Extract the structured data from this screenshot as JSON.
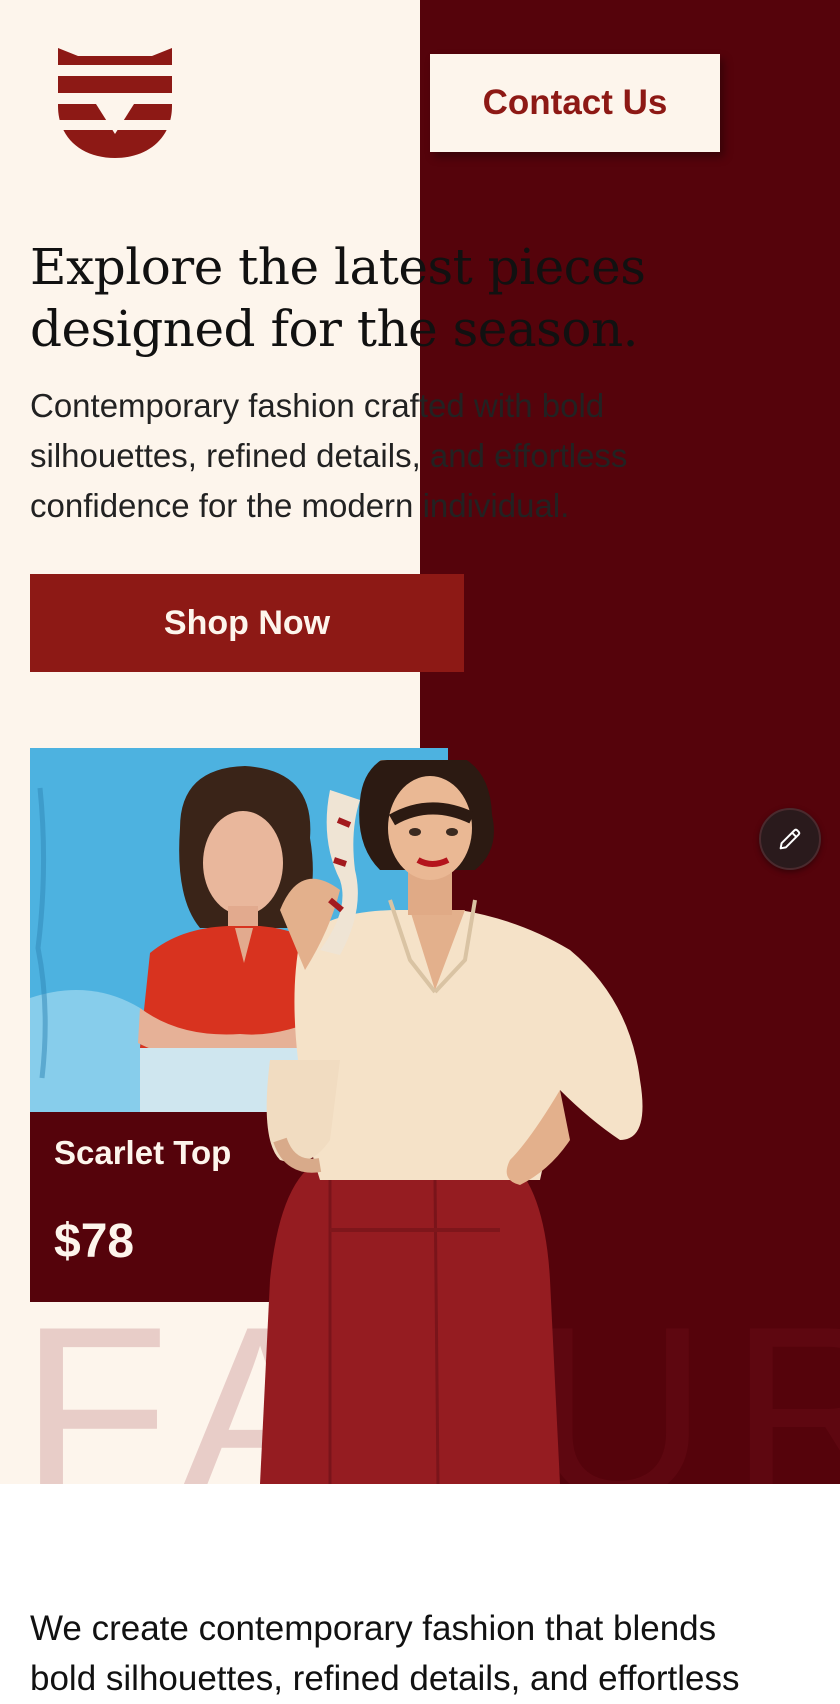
{
  "header": {
    "logo_icon": "fox-stripes-logo",
    "contact_button": "Contact Us"
  },
  "hero": {
    "headline": [
      "Explore the latest pieces",
      "designed for the season."
    ],
    "subtext": [
      "Contemporary fashion crafted with bold",
      "silhouettes, refined details, and effortless",
      "confidence for the modern individual."
    ],
    "shop_button": "Shop Now",
    "watermark": "FAVUR",
    "edit_icon": "pencil-icon"
  },
  "product_card": {
    "name": "Scarlet Top",
    "price": "$78"
  },
  "about": {
    "text": [
      "We create contemporary fashion that blends",
      "bold silhouettes, refined details, and effortless"
    ]
  },
  "colors": {
    "cream": "#fdf5ec",
    "maroon": "#55030b",
    "brand_red": "#8d1915"
  }
}
